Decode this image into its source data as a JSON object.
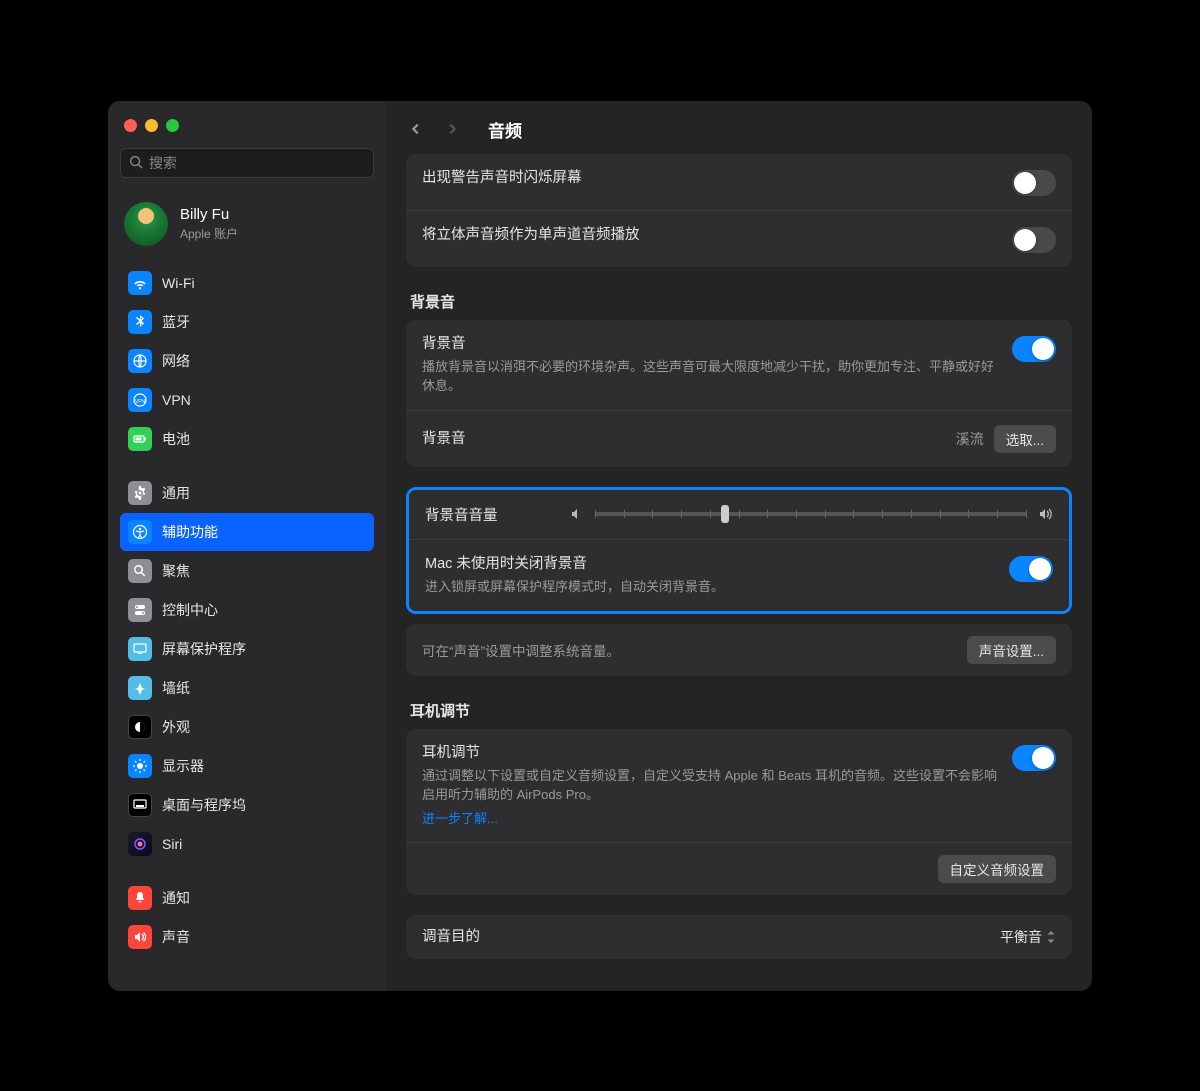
{
  "search": {
    "placeholder": "搜索"
  },
  "profile": {
    "name": "Billy Fu",
    "sub": "Apple 账户"
  },
  "sidebar": {
    "items": [
      {
        "label": "Wi-Fi"
      },
      {
        "label": "蓝牙"
      },
      {
        "label": "网络"
      },
      {
        "label": "VPN"
      },
      {
        "label": "电池"
      },
      {
        "label": "通用"
      },
      {
        "label": "辅助功能"
      },
      {
        "label": "聚焦"
      },
      {
        "label": "控制中心"
      },
      {
        "label": "屏幕保护程序"
      },
      {
        "label": "墙纸"
      },
      {
        "label": "外观"
      },
      {
        "label": "显示器"
      },
      {
        "label": "桌面与程序坞"
      },
      {
        "label": "Siri"
      },
      {
        "label": "通知"
      },
      {
        "label": "声音"
      }
    ]
  },
  "page": {
    "title": "音频",
    "group1": {
      "flash": "出现警告声音时闪烁屏幕",
      "mono": "将立体声音频作为单声道音频播放"
    },
    "section_bg": "背景音",
    "bg": {
      "title": "背景音",
      "desc": "播放背景音以消弭不必要的环境杂声。这些声音可最大限度地减少干扰，助你更加专注、平静或好好休息。",
      "picker_label": "背景音",
      "picker_value": "溪流",
      "picker_button": "选取...",
      "volume_label": "背景音音量",
      "volume_value": 30,
      "mac_off_title": "Mac 未使用时关闭背景音",
      "mac_off_desc": "进入锁屏或屏幕保护程序模式时，自动关闭背景音。"
    },
    "sound_footer": "可在“声音”设置中调整系统音量。",
    "sound_button": "声音设置...",
    "section_headphone": "耳机调节",
    "headphone": {
      "title": "耳机调节",
      "desc": "通过调整以下设置或自定义音频设置，自定义受支持 Apple 和 Beats 耳机的音频。这些设置不会影响启用听力辅助的 AirPods Pro。",
      "link": "进一步了解...",
      "custom_button": "自定义音频设置"
    },
    "tuning": {
      "label": "调音目的",
      "value": "平衡音"
    }
  }
}
